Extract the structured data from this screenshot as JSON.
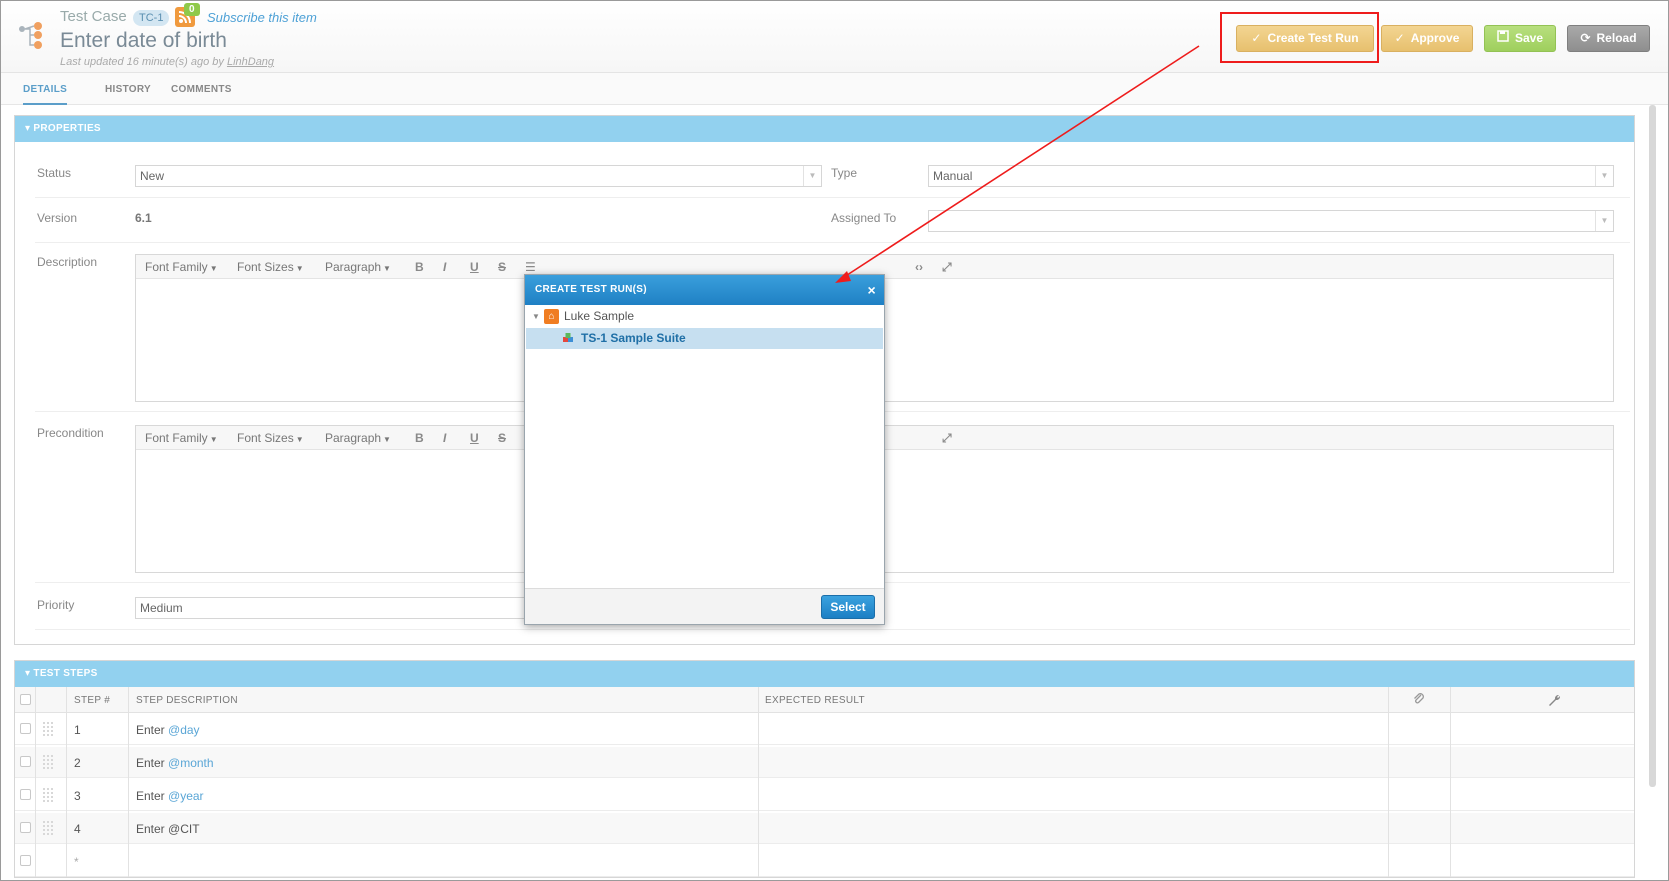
{
  "header": {
    "item_type": "Test Case",
    "item_id": "TC-1",
    "rss_count": "0",
    "subscribe_label": "Subscribe this item",
    "title": "Enter date of birth",
    "updated_prefix": "Last updated 16 minute(s) ago by",
    "updated_user": "LinhDang"
  },
  "toolbar": {
    "create_test_run_label": "Create Test Run",
    "approve_label": "Approve",
    "save_label": "Save",
    "reload_label": "Reload"
  },
  "tabs": [
    {
      "label": "DETAILS",
      "active": true
    },
    {
      "label": "HISTORY",
      "active": false
    },
    {
      "label": "COMMENTS",
      "active": false
    }
  ],
  "properties": {
    "section_title": "PROPERTIES",
    "status_label": "Status",
    "status_value": "New",
    "type_label": "Type",
    "type_value": "Manual",
    "version_label": "Version",
    "version_value": "6.1",
    "assigned_label": "Assigned To",
    "assigned_value": "",
    "description_label": "Description",
    "precondition_label": "Precondition",
    "priority_label": "Priority",
    "priority_value": "Medium"
  },
  "editor_toolbar": {
    "font_family": "Font Family",
    "font_sizes": "Font Sizes",
    "paragraph": "Paragraph"
  },
  "test_steps": {
    "section_title": "TEST STEPS",
    "columns": [
      "STEP #",
      "STEP DESCRIPTION",
      "EXPECTED RESULT"
    ],
    "rows": [
      {
        "step": "1",
        "prefix": "Enter ",
        "param": "@day",
        "expected": ""
      },
      {
        "step": "2",
        "prefix": "Enter ",
        "param": "@month",
        "expected": ""
      },
      {
        "step": "3",
        "prefix": "Enter ",
        "param": "@year",
        "expected": ""
      },
      {
        "step": "4",
        "prefix": "Enter @CIT",
        "param": "",
        "expected": ""
      }
    ],
    "new_row_marker": "*"
  },
  "modal": {
    "title": "CREATE TEST RUN(S)",
    "close_glyph": "×",
    "tree": [
      {
        "label": "Luke Sample",
        "selected": false
      },
      {
        "label": "TS-1 Sample Suite",
        "selected": true
      }
    ],
    "select_label": "Select"
  },
  "colors": {
    "accent_blue": "#1f80c4",
    "section_header": "#92d1ef",
    "highlight_red": "#ee1c1c",
    "approve_gold": "#e7c06e",
    "save_green": "#9fcf5d"
  }
}
